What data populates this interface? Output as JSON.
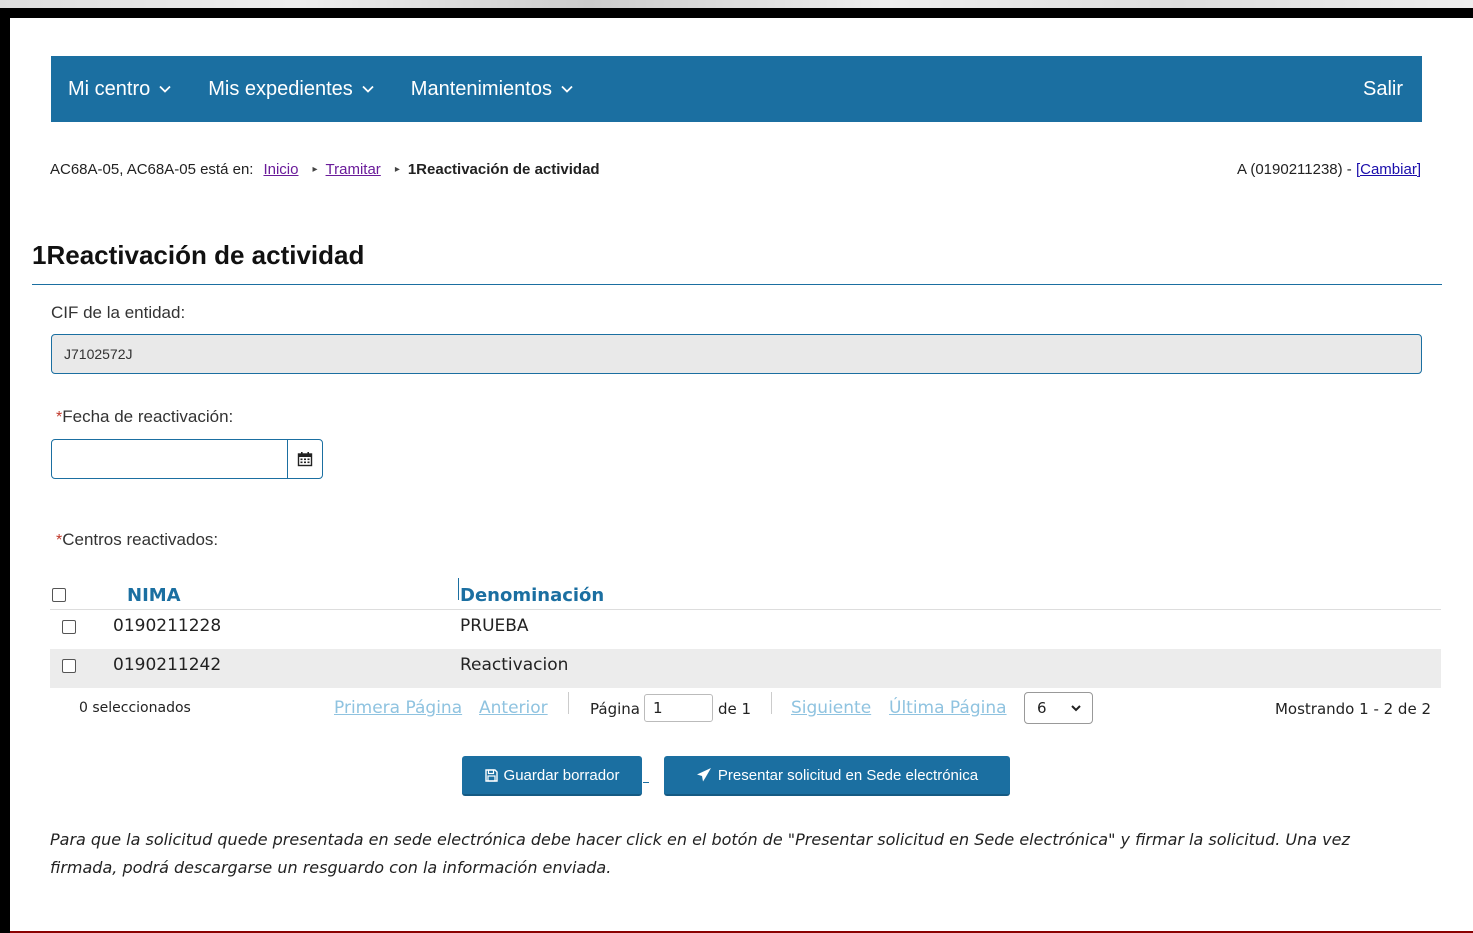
{
  "navbar": {
    "items": [
      {
        "label": "Mi centro"
      },
      {
        "label": "Mis expedientes"
      },
      {
        "label": "Mantenimientos"
      }
    ],
    "logout": "Salir",
    "background": "#1b6fa1"
  },
  "breadcrumb": {
    "prefix": "AC68A-05, AC68A-05 está en:",
    "links": [
      "Inicio",
      "Tramitar"
    ],
    "current": "1Reactivación de actividad"
  },
  "user": {
    "text": "A (0190211238) - ",
    "change_link": "[Cambiar]"
  },
  "page_title": "1Reactivación de actividad",
  "form": {
    "cif_label": "CIF de la entidad:",
    "cif_value": "J7102572J",
    "date_label": "Fecha de reactivación:",
    "date_value": "",
    "centros_label": "Centros reactivados:",
    "required_mark": "*"
  },
  "table": {
    "headers": [
      "NIMA",
      "Denominación"
    ],
    "rows": [
      {
        "nima": "0190211228",
        "denominacion": "PRUEBA"
      },
      {
        "nima": "0190211242",
        "denominacion": "Reactivacion"
      }
    ]
  },
  "pager": {
    "selected": "0 seleccionados",
    "first": "Primera Página",
    "prev": "Anterior",
    "page_label": "Página",
    "page_value": "1",
    "of_label": "de 1",
    "next": "Siguiente",
    "last": "Última Página",
    "per_page": "6",
    "showing": "Mostrando 1 - 2 de 2"
  },
  "buttons": {
    "save_draft": "Guardar borrador",
    "submit": "Presentar solicitud en Sede electrónica"
  },
  "note": "Para que la solicitud quede presentada en sede electrónica debe hacer click en el botón de \"Presentar solicitud en Sede electrónica\" y firmar la solicitud. Una vez firmada, podrá descargarse un resguardo con la información enviada."
}
